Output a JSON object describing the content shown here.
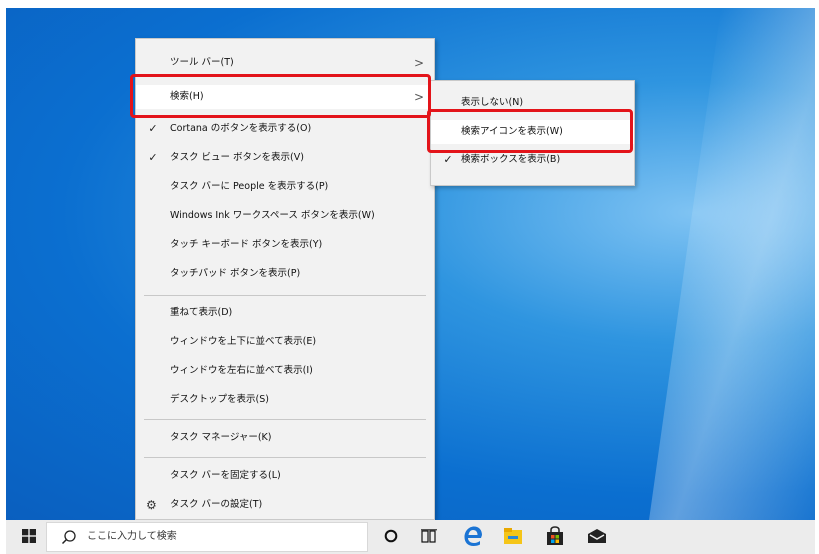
{
  "main_menu": {
    "items": [
      {
        "label": "ツール バー(T)",
        "submenu": true
      },
      {
        "label": "検索(H)",
        "submenu": true
      },
      {
        "label": "Cortana のボタンを表示する(O)",
        "checked": true
      },
      {
        "label": "タスク ビュー ボタンを表示(V)",
        "checked": true
      },
      {
        "label": "タスク バーに People を表示する(P)"
      },
      {
        "label": "Windows Ink ワークスペース ボタンを表示(W)"
      },
      {
        "label": "タッチ キーボード ボタンを表示(Y)"
      },
      {
        "label": "タッチパッド ボタンを表示(P)"
      },
      {
        "label": "重ねて表示(D)"
      },
      {
        "label": "ウィンドウを上下に並べて表示(E)"
      },
      {
        "label": "ウィンドウを左右に並べて表示(I)"
      },
      {
        "label": "デスクトップを表示(S)"
      },
      {
        "label": "タスク マネージャー(K)"
      },
      {
        "label": "タスク バーを固定する(L)"
      },
      {
        "label": "タスク バーの設定(T)"
      }
    ],
    "check_glyph": "✓",
    "submenu_arrow": ">"
  },
  "sub_menu": {
    "items": [
      {
        "label": "表示しない(N)"
      },
      {
        "label": "検索アイコンを表示(W)"
      },
      {
        "label": "検索ボックスを表示(B)",
        "checked": true
      }
    ]
  },
  "taskbar": {
    "search_placeholder": "ここに入力して検索",
    "icons": [
      "windows-start-icon",
      "search-icon",
      "cortana-icon",
      "task-view-icon",
      "edge-icon",
      "file-explorer-icon",
      "store-icon",
      "mail-icon"
    ]
  },
  "colors": {
    "highlight": "#e3141a",
    "desktop": "#0b6fd0",
    "menu_bg": "#f2f2f2"
  }
}
